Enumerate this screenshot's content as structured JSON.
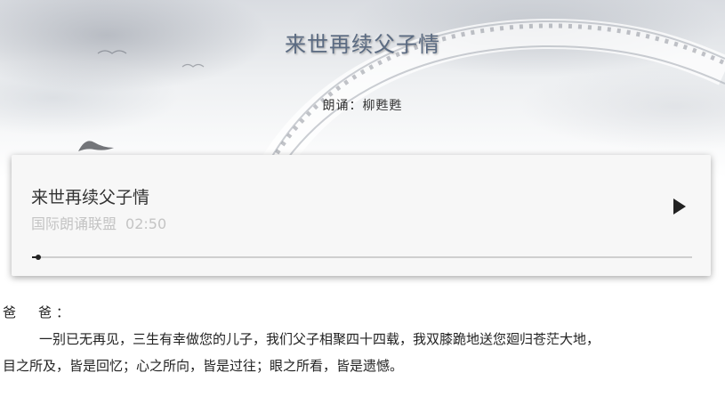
{
  "header": {
    "title": "来世再续父子情",
    "reader_label": "朗诵：柳甦甦"
  },
  "player": {
    "title": "来世再续父子情",
    "artist": "国际朗诵联盟",
    "duration": "02:50",
    "play_icon": "play-icon",
    "progress": 0.01
  },
  "letter": {
    "salutation": "爸　爸：",
    "paragraph_line1": "一别已无再见，三生有幸做您的儿子，我们父子相聚四十四载，我双膝跪地送您廻归苍茫大地，",
    "paragraph_line2": "目之所及，皆是回忆；心之所向，皆是过往；眼之所看，皆是遗憾。"
  },
  "colors": {
    "title": "#5b6b82",
    "card_bg": "#f7f7f7",
    "meta_text": "#c4c4c4",
    "accent": "#222222"
  }
}
